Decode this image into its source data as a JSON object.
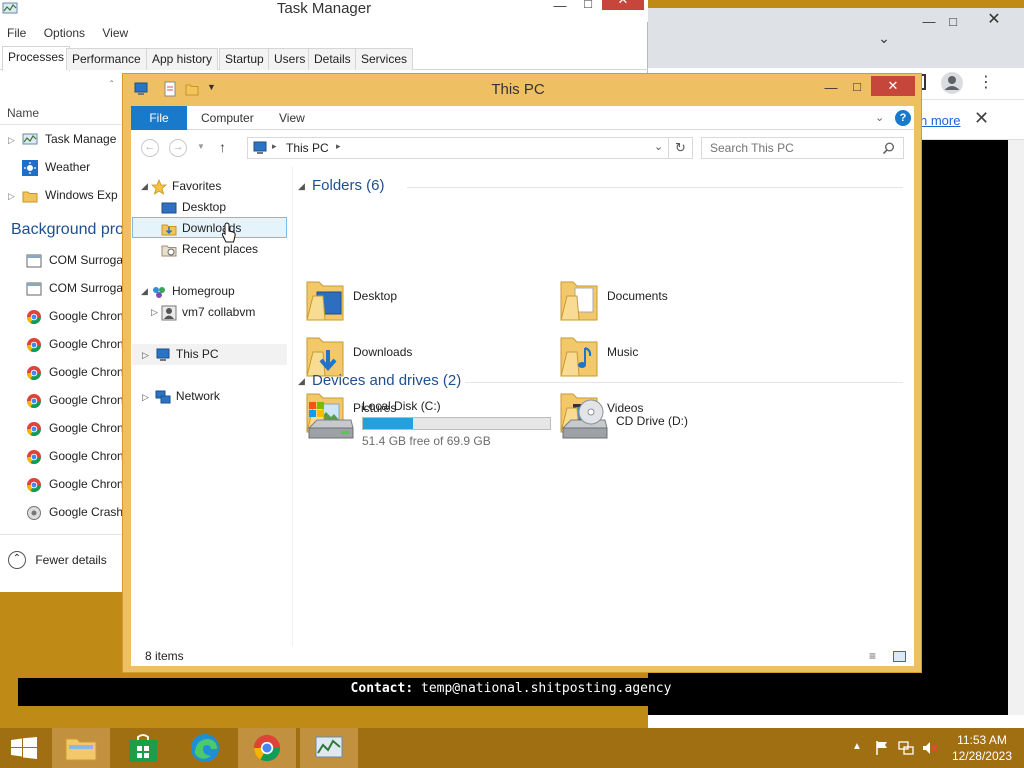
{
  "task_manager": {
    "title": "Task Manager",
    "menu": [
      "File",
      "Options",
      "View"
    ],
    "tabs": [
      "Processes",
      "Performance",
      "App history",
      "Startup",
      "Users",
      "Details",
      "Services"
    ],
    "column_name": "Name",
    "apps": [
      "Task Manage",
      "Weather",
      "Windows Exp"
    ],
    "background_header": "Background pro",
    "background_processes": [
      "COM Surroga",
      "COM Surroga",
      "Google Chron",
      "Google Chron",
      "Google Chron",
      "Google Chron",
      "Google Chron",
      "Google Chron",
      "Google Chron",
      "Google Crash"
    ],
    "fewer_details": "Fewer details"
  },
  "chrome": {
    "learn_more": "n more"
  },
  "explorer": {
    "title": "This PC",
    "ribbon_tabs": [
      "File",
      "Computer",
      "View"
    ],
    "address_path": "This PC",
    "search_placeholder": "Search This PC",
    "nav": {
      "favorites": "Favorites",
      "desktop": "Desktop",
      "downloads": "Downloads",
      "recent": "Recent places",
      "homegroup": "Homegroup",
      "homegroup_user": "vm7 collabvm",
      "this_pc": "This PC",
      "network": "Network"
    },
    "folders_header": "Folders (6)",
    "folders": [
      "Desktop",
      "Documents",
      "Downloads",
      "Music",
      "Pictures",
      "Videos"
    ],
    "devices_header": "Devices and drives (2)",
    "local_disk": {
      "name": "Local Disk (C:)",
      "free_text": "51.4 GB free of 69.9 GB",
      "used_fraction": 0.265
    },
    "cd_drive": "CD Drive (D:)",
    "status": "8 items"
  },
  "banner": {
    "label": "Contact:",
    "email": "temp@national.shitposting.agency"
  },
  "taskbar": {
    "time": "11:53 AM",
    "date": "12/28/2023"
  },
  "colors": {
    "desktop": "#c08a16",
    "window_frame": "#efc063",
    "accent": "#1979ca",
    "close": "#c7463c"
  }
}
